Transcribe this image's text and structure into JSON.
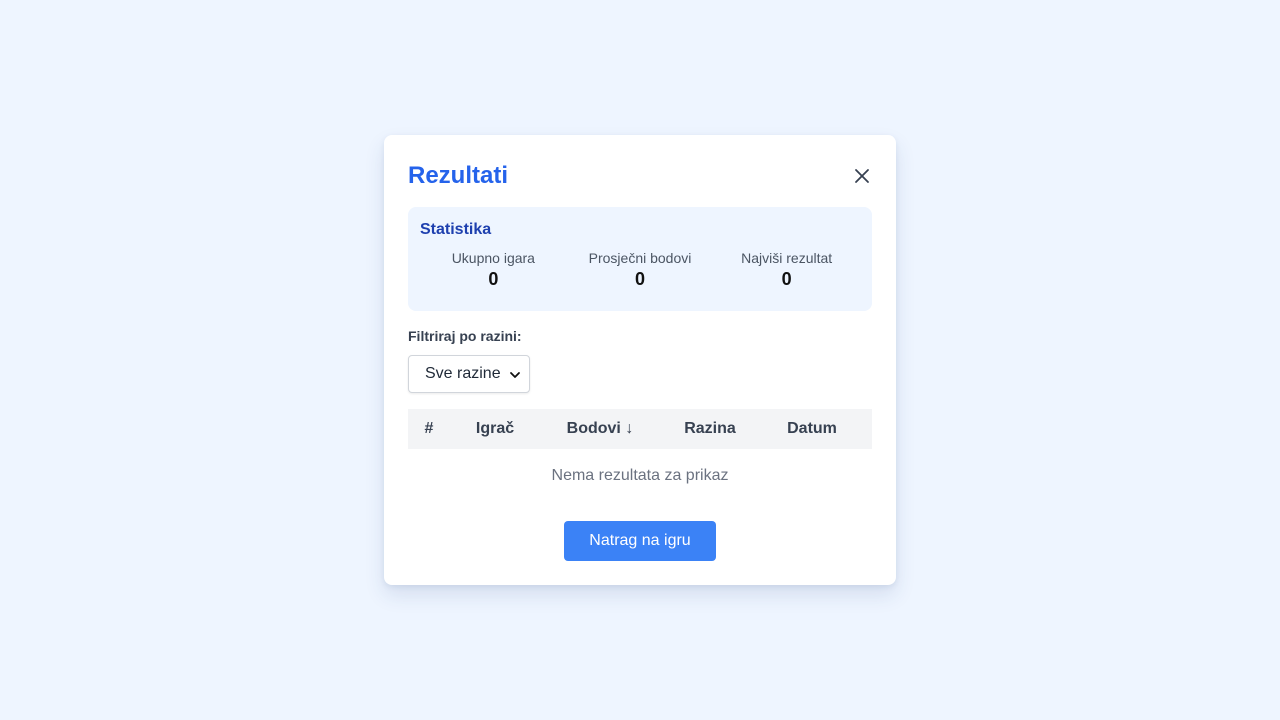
{
  "modal": {
    "title": "Rezultati",
    "close_icon": "close-icon"
  },
  "stats": {
    "title": "Statistika",
    "items": [
      {
        "label": "Ukupno igara",
        "value": "0"
      },
      {
        "label": "Prosječni bodovi",
        "value": "0"
      },
      {
        "label": "Najviši rezultat",
        "value": "0"
      }
    ]
  },
  "filter": {
    "label": "Filtriraj po razini:",
    "selected": "Sve razine",
    "icon": "chevron-down-icon"
  },
  "table": {
    "columns": [
      "#",
      "Igrač",
      "Bodovi ↓",
      "Razina",
      "Datum"
    ],
    "empty_message": "Nema rezultata za prikaz"
  },
  "actions": {
    "back_label": "Natrag na igru"
  },
  "colors": {
    "background": "#eef5ff",
    "accent": "#2563eb",
    "button": "#3b82f6",
    "stats_title": "#1e40af"
  }
}
